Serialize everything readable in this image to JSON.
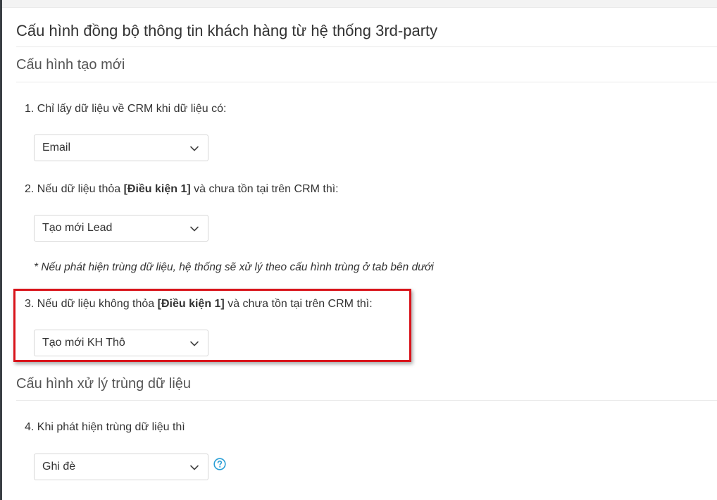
{
  "page_title": "Cấu hình đồng bộ thông tin khách hàng từ hệ thống 3rd-party",
  "section_create": {
    "title": "Cấu hình tạo mới"
  },
  "q1": {
    "label": "1. Chỉ lấy dữ liệu về CRM khi dữ liệu có:",
    "selected": "Email"
  },
  "q2": {
    "label_prefix": "2. Nếu dữ liệu thỏa ",
    "label_bold": "[Điều kiện 1]",
    "label_suffix": " và chưa tồn tại trên CRM thì:",
    "selected": "Tạo mới Lead"
  },
  "note": "* Nếu phát hiện trùng dữ liệu, hệ thống sẽ xử lý theo cấu hình trùng ở tab bên dưới",
  "q3": {
    "label_prefix": "3. Nếu dữ liệu không thỏa ",
    "label_bold": "[Điều kiện 1]",
    "label_suffix": " và chưa tồn tại trên CRM thì:",
    "selected": "Tạo mới KH Thô"
  },
  "section_duplicate": {
    "title": "Cấu hình xử lý trùng dữ liệu"
  },
  "q4": {
    "label": "4. Khi phát hiện trùng dữ liệu thì",
    "selected": "Ghi đè"
  },
  "icons": {
    "chevron": "chevron-down-icon",
    "help": "question-circle-icon"
  },
  "colors": {
    "highlight_border": "#d9141b",
    "help_icon": "#2a9fd6"
  }
}
